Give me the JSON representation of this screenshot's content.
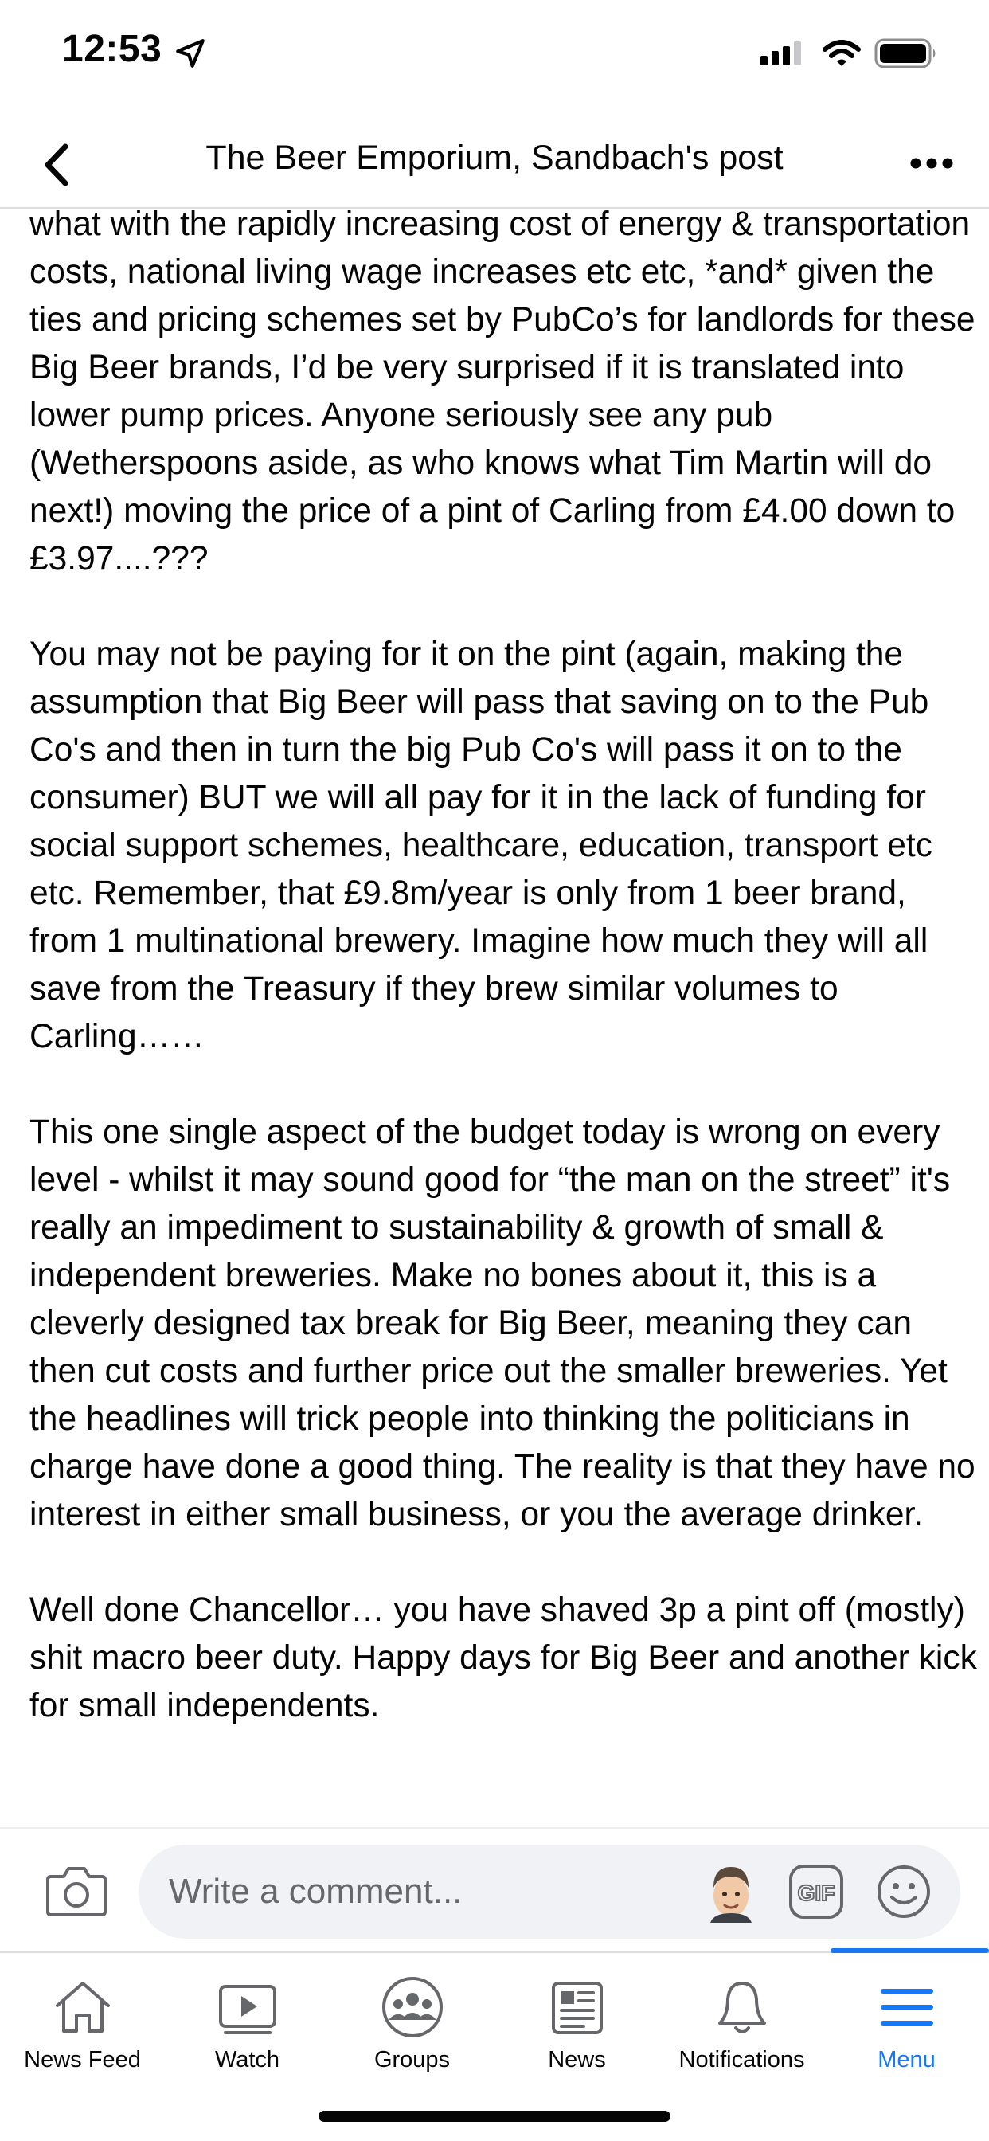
{
  "status_bar": {
    "time": "12:53"
  },
  "header": {
    "title": "The Beer Emporium, Sandbach's post"
  },
  "post": {
    "paragraphs": [
      "what with the rapidly increasing cost of energy & transportation costs, national living wage increases etc etc, *and* given the ties and pricing schemes set by PubCo’s for landlords for these Big Beer brands, I’d be very surprised if it is translated into lower pump prices. Anyone seriously see any pub (Wetherspoons aside, as who knows what Tim Martin will do next!) moving the price of a pint of Carling from £4.00 down to £3.97....???",
      "You may not be paying for it on the pint (again, making the assumption that Big Beer will pass that saving on to the Pub Co's and then in turn the big Pub Co's will pass it on to the consumer) BUT we will all pay for it in the lack of funding for social support schemes, healthcare, education, transport etc etc. Remember, that £9.8m/year is only from 1 beer brand, from 1 multinational brewery. Imagine how much they will all save from the Treasury if they brew similar volumes to Carling……",
      "This one single aspect of the budget today is wrong on every level - whilst it may sound good for “the man on the street” it's really an impediment to sustainability & growth of small & independent breweries. Make no bones about it, this is a cleverly designed tax break for Big Beer, meaning they can then cut costs and further price out the smaller breweries. Yet the headlines will trick people into thinking the politicians in charge have done a good thing. The reality is that they have no interest in either small business, or you the average drinker.",
      "Well done Chancellor… you have shaved 3p a pint off (mostly) shit macro beer duty. Happy days for Big Beer and another kick for small independents."
    ]
  },
  "comment": {
    "placeholder": "Write a comment..."
  },
  "tabs": [
    {
      "label": "News Feed",
      "icon": "home-icon"
    },
    {
      "label": "Watch",
      "icon": "watch-icon"
    },
    {
      "label": "Groups",
      "icon": "groups-icon"
    },
    {
      "label": "News",
      "icon": "news-icon"
    },
    {
      "label": "Notifications",
      "icon": "bell-icon"
    },
    {
      "label": "Menu",
      "icon": "menu-icon",
      "active": true
    }
  ],
  "colors": {
    "accent": "#1877f2",
    "text": "#050505",
    "secondary_text": "#65676b",
    "input_bg": "#f0f2f5"
  }
}
